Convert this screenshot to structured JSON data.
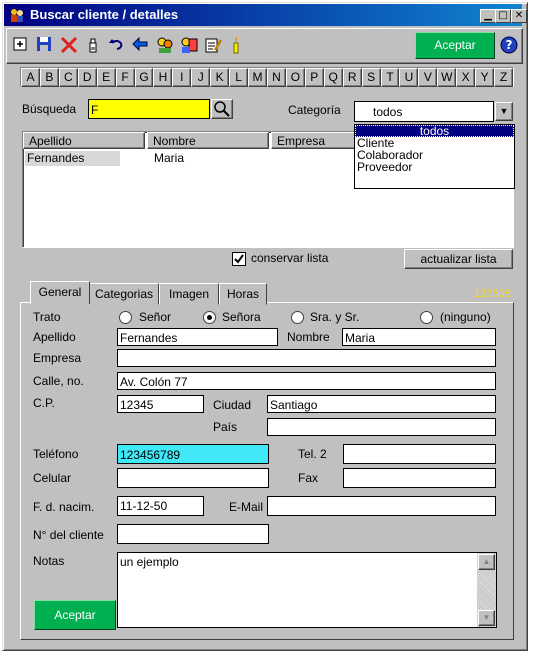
{
  "window": {
    "title": "Buscar cliente / detalles"
  },
  "toolbar": {
    "accept_label": "Aceptar",
    "help_label": "?"
  },
  "alphabet": [
    "A",
    "B",
    "C",
    "D",
    "E",
    "F",
    "G",
    "H",
    "I",
    "J",
    "K",
    "L",
    "M",
    "N",
    "O",
    "P",
    "Q",
    "R",
    "S",
    "T",
    "U",
    "V",
    "W",
    "X",
    "Y",
    "Z"
  ],
  "search": {
    "label": "Búsqueda",
    "value": "F"
  },
  "category": {
    "label": "Categoría",
    "selected": "todos",
    "options": [
      "todos",
      "Cliente",
      "Colaborador",
      "Proveedor"
    ]
  },
  "results": {
    "columns": [
      "Apellido",
      "Nombre",
      "Empresa"
    ],
    "rows": [
      [
        "Fernandes",
        "Maria",
        ""
      ]
    ],
    "keep_list_label": "conservar lista",
    "keep_list_checked": true,
    "refresh_label": "actualizar lista"
  },
  "tabs": [
    "General",
    "Categorias",
    "Imagen",
    "Horas"
  ],
  "record_number": "127508",
  "form": {
    "trato_label": "Trato",
    "trato_options": [
      "Señor",
      "Señora",
      "Sra. y Sr.",
      "(ninguno)"
    ],
    "trato_selected": "Señora",
    "apellido_label": "Apellido",
    "apellido": "Fernandes",
    "nombre_label": "Nombre",
    "nombre": "Maria",
    "empresa_label": "Empresa",
    "empresa": "",
    "calle_label": "Calle, no.",
    "calle": "Av. Colón 77",
    "cp_label": "C.P.",
    "cp": "12345",
    "ciudad_label": "Ciudad",
    "ciudad": "Santiago",
    "pais_label": "País",
    "pais": "",
    "telefono_label": "Teléfono",
    "telefono": "123456789",
    "tel2_label": "Tel. 2",
    "tel2": "",
    "celular_label": "Celular",
    "celular": "",
    "fax_label": "Fax",
    "fax": "",
    "nacim_label": "F. d. nacim.",
    "nacim": "11-12-50",
    "email_label": "E-Mail",
    "email": "",
    "cliente_label": "N° del cliente",
    "cliente": "",
    "notas_label": "Notas",
    "notas": "un ejemplo"
  },
  "bottom": {
    "accept_label": "Aceptar"
  },
  "colors": {
    "title_bar": "#000080",
    "accept_green": "#00b050",
    "search_yellow": "#ffff00",
    "phone_cyan": "#40e8f8",
    "record_number": "#ffd800"
  }
}
